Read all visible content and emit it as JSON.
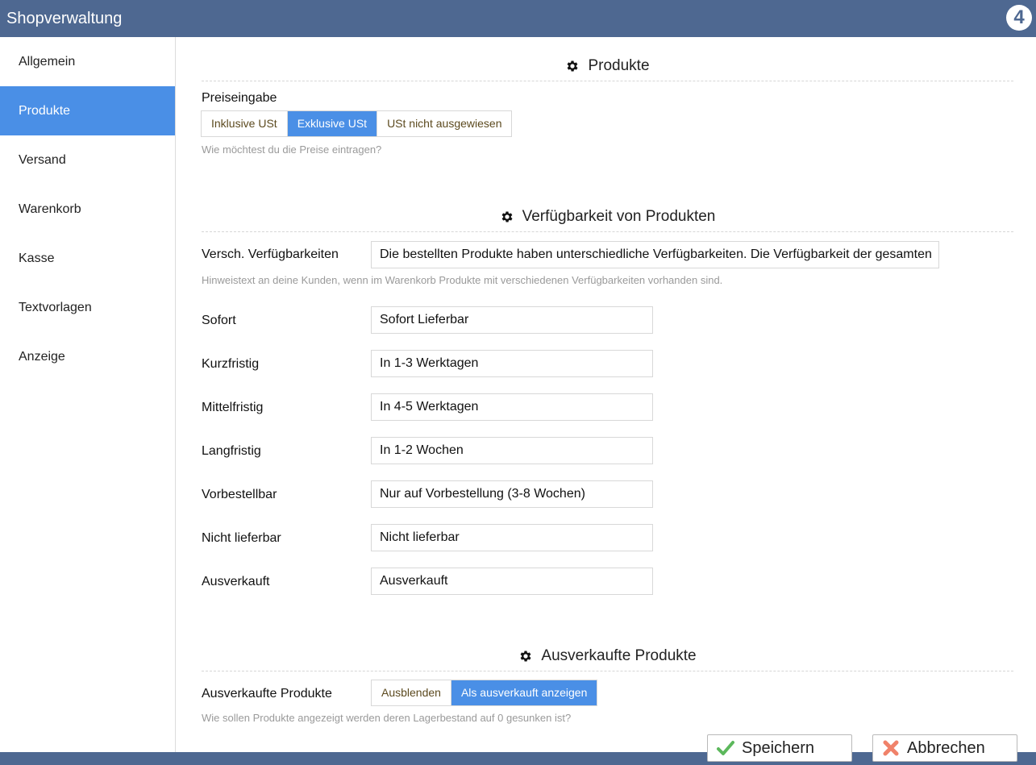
{
  "app": {
    "title": "Shopverwaltung",
    "logo_text": "4"
  },
  "sidebar": {
    "items": [
      {
        "label": "Allgemein"
      },
      {
        "label": "Produkte"
      },
      {
        "label": "Versand"
      },
      {
        "label": "Warenkorb"
      },
      {
        "label": "Kasse"
      },
      {
        "label": "Textvorlagen"
      },
      {
        "label": "Anzeige"
      }
    ],
    "active": "Produkte"
  },
  "products": {
    "heading": "Produkte",
    "price_input": {
      "label": "Preiseingabe",
      "options": [
        "Inklusive USt",
        "Exklusive USt",
        "USt nicht ausgewiesen"
      ],
      "selected": "Exklusive USt",
      "hint": "Wie möchtest du die Preise eintragen?"
    }
  },
  "availability": {
    "heading": "Verfügbarkeit von Produkten",
    "mixed": {
      "label": "Versch. Verfügbarkeiten",
      "value": "Die bestellten Produkte haben unterschiedliche Verfügbarkeiten. Die Verfügbarkeit der gesamten",
      "hint": "Hinweistext an deine Kunden, wenn im Warenkorb Produkte mit verschiedenen Verfügbarkeiten vorhanden sind."
    },
    "rows": [
      {
        "label": "Sofort",
        "value": "Sofort Lieferbar"
      },
      {
        "label": "Kurzfristig",
        "value": "In 1-3 Werktagen"
      },
      {
        "label": "Mittelfristig",
        "value": "In 4-5 Werktagen"
      },
      {
        "label": "Langfristig",
        "value": "In 1-2 Wochen"
      },
      {
        "label": "Vorbestellbar",
        "value": "Nur auf Vorbestellung (3-8 Wochen)"
      },
      {
        "label": "Nicht lieferbar",
        "value": "Nicht lieferbar"
      },
      {
        "label": "Ausverkauft",
        "value": "Ausverkauft"
      }
    ]
  },
  "soldout": {
    "heading": "Ausverkaufte Produkte",
    "label": "Ausverkaufte Produkte",
    "options": [
      "Ausblenden",
      "Als ausverkauft anzeigen"
    ],
    "selected": "Als ausverkauft anzeigen",
    "hint": "Wie sollen Produkte angezeigt werden deren Lagerbestand auf 0 gesunken ist?"
  },
  "footer": {
    "save_label": "Speichern",
    "cancel_label": "Abbrechen"
  },
  "colors": {
    "header": "#4e6891",
    "accent": "#4a8fe6",
    "save_icon": "#5cb85c",
    "cancel_icon": "#f0826a"
  },
  "icons": {
    "section": "gear-icon",
    "save": "checkmark-icon",
    "cancel": "cross-icon"
  }
}
